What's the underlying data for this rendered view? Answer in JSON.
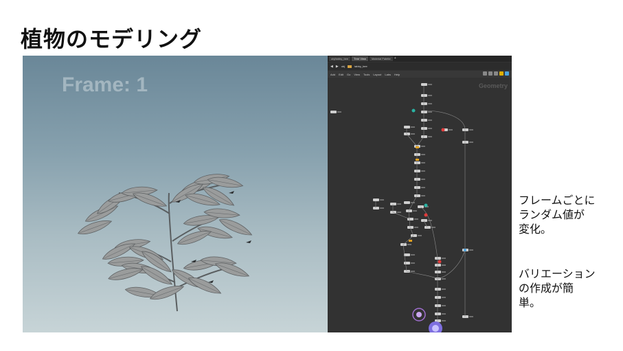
{
  "slide": {
    "title": "植物のモデリング"
  },
  "viewport": {
    "frame_label": "Frame: 1"
  },
  "node_editor": {
    "tabs": [
      {
        "label": "obj/tabby_bee",
        "active": false
      },
      {
        "label": "Tree View",
        "active": true
      },
      {
        "label": "Material Palette",
        "active": false
      }
    ],
    "tab_add": "+",
    "path": "tabby_bee",
    "path_root": "obj",
    "menu": [
      "Add",
      "Edit",
      "Go",
      "View",
      "Tools",
      "Layout",
      "Labs",
      "Help"
    ],
    "context_label": "Geometry"
  },
  "notes": {
    "note1_lines": [
      "フレームごとに",
      "ランダム値が",
      "変化。"
    ],
    "note2_lines": [
      "バリエーション",
      "の作成が簡",
      "単。"
    ]
  },
  "colors": {
    "viewport_top": "#6a8798",
    "viewport_bottom": "#c7d4d7",
    "editor_bg": "#323232",
    "node": "#d8d8d8",
    "wire": "#8a8a8a"
  }
}
